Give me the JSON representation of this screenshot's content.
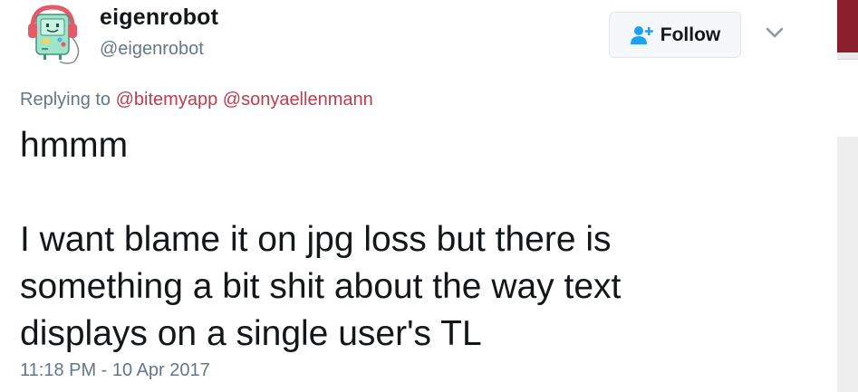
{
  "user": {
    "display_name": "eigenrobot",
    "screen_name": "@eigenrobot"
  },
  "follow_button": {
    "label": "Follow",
    "icon": "add-user-icon"
  },
  "menu": {
    "icon": "chevron-down-icon"
  },
  "reply_context": {
    "prefix": "Replying to",
    "mentions": [
      "@bitemyapp",
      "@sonyaellenmann"
    ]
  },
  "tweet": {
    "lines": [
      "hmmm",
      "I want blame it on jpg loss but there is",
      "something a bit shit about the way text",
      "displays on a single user's TL"
    ],
    "timestamp": "11:18 PM - 10 Apr 2017"
  },
  "colors": {
    "text": "#14171a",
    "secondary": "#657786",
    "mention": "#c13a4e",
    "follow_icon": "#1da1f2",
    "avatar_body": "#9fe3c8",
    "avatar_headphones": "#e35a6a"
  }
}
